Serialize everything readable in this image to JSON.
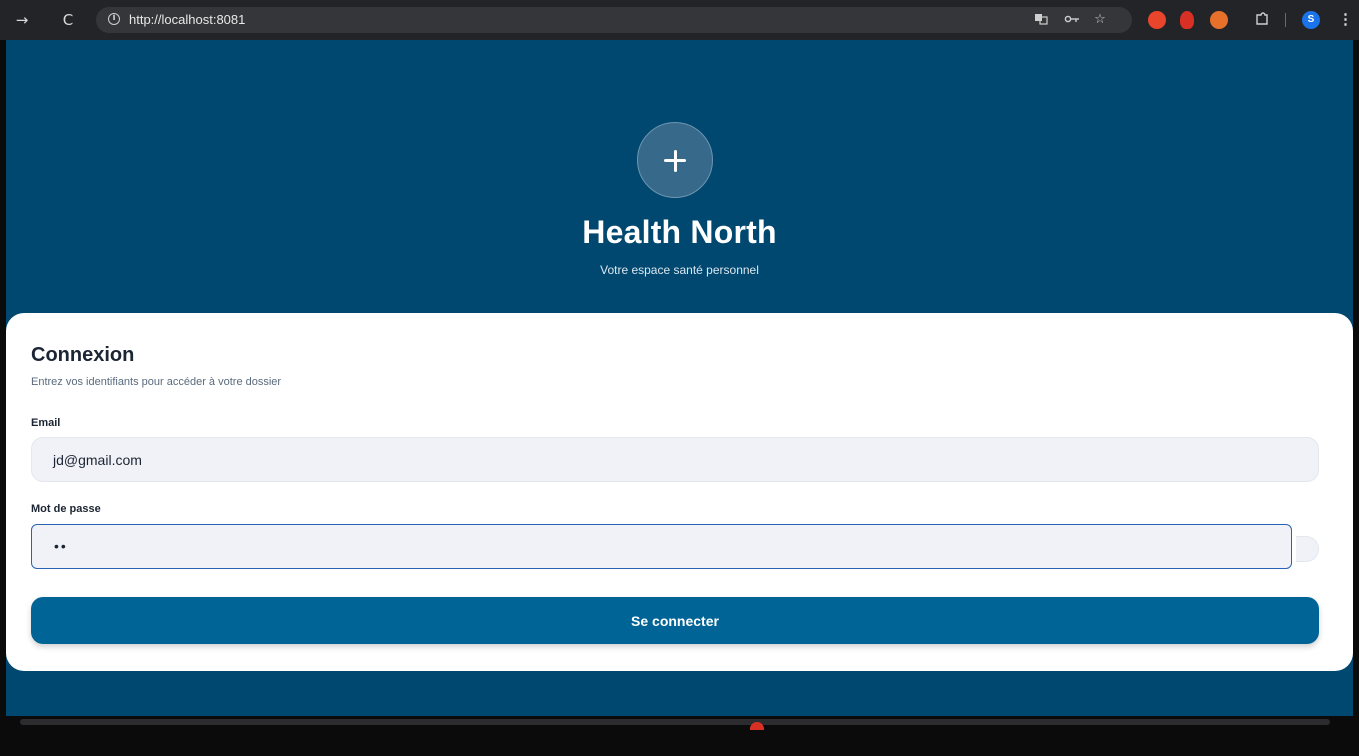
{
  "browser": {
    "url": "http://localhost:8081",
    "forward_icon": "→",
    "reload_icon": "C",
    "profile_initial": "S",
    "url_icons": [
      "translate-icon",
      "key-icon",
      "star-icon"
    ],
    "extension_colors": [
      "#e8452c",
      "#d93025",
      "#e7712a"
    ]
  },
  "brand": {
    "title": "Health North",
    "subtitle": "Votre espace santé personnel",
    "logo_icon": "plus-icon"
  },
  "login": {
    "title": "Connexion",
    "description": "Entrez vos identifiants pour accéder à votre dossier",
    "email_label": "Email",
    "email_value": "jd@gmail.com",
    "password_label": "Mot de passe",
    "password_value": "••",
    "submit_label": "Se connecter"
  },
  "colors": {
    "page_background": "#004870",
    "button": "#006496",
    "focus_border": "#2a63b6"
  }
}
